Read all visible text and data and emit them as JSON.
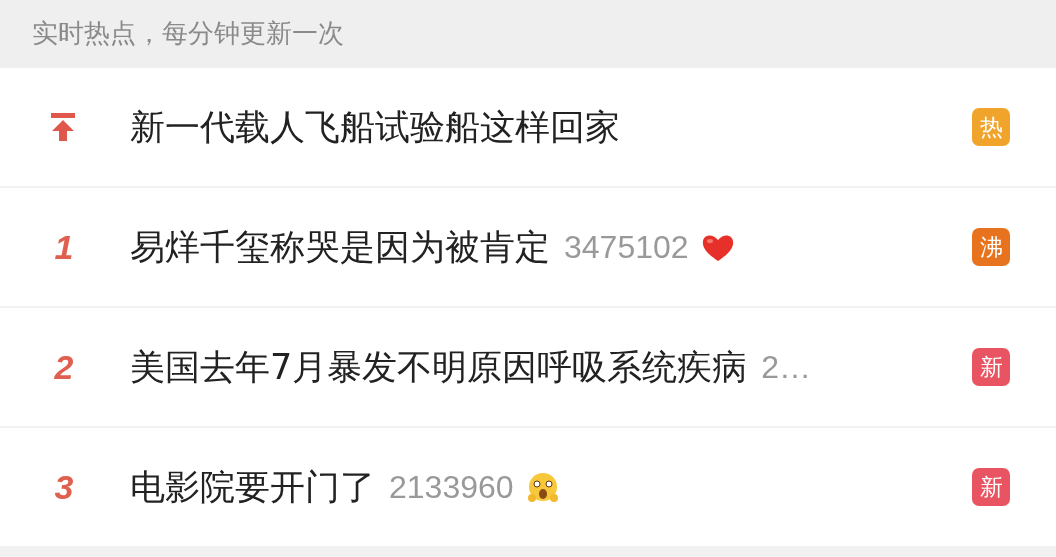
{
  "header": {
    "text": "实时热点，每分钟更新一次"
  },
  "rows": [
    {
      "kind": "pinned",
      "title": "新一代载人飞船试验船这样回家",
      "badge": {
        "text": "热",
        "color": "#f0a42c"
      }
    },
    {
      "kind": "ranked",
      "rank": "1",
      "title": "易烊千玺称哭是因为被肯定",
      "count": "3475102",
      "icon": {
        "kind": "heart"
      },
      "badge": {
        "text": "沸",
        "color": "#e8731e"
      }
    },
    {
      "kind": "ranked",
      "rank": "2",
      "title": "美国去年7月暴发不明原因呼吸系统疾病",
      "count": "2…",
      "badge": {
        "text": "新",
        "color": "#e85461"
      }
    },
    {
      "kind": "ranked",
      "rank": "3",
      "title": "电影院要开门了",
      "count": "2133960",
      "icon": {
        "kind": "face"
      },
      "badge": {
        "text": "新",
        "color": "#e85461"
      }
    }
  ]
}
